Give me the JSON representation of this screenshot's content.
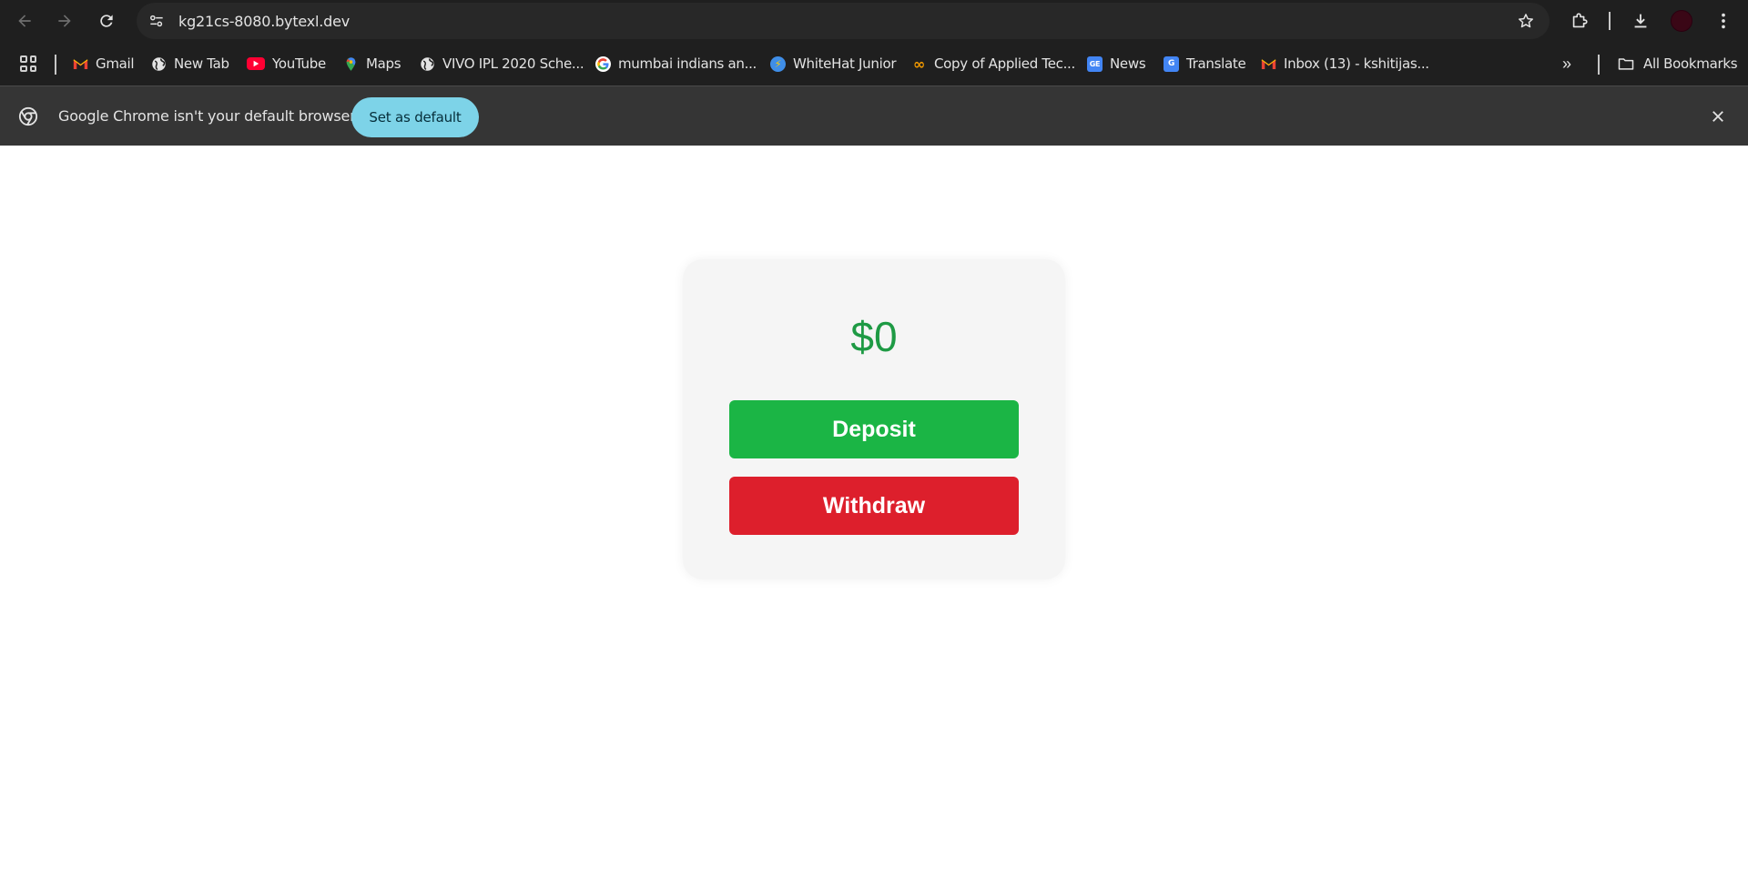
{
  "browser": {
    "url": "kg21cs-8080.bytexl.dev",
    "icons": {
      "back": "arrow-left-icon",
      "forward": "arrow-right-icon",
      "reload": "reload-icon",
      "site_settings": "tune-icon",
      "bookmark_star": "star-icon",
      "extensions": "puzzle-icon",
      "downloads": "download-icon",
      "menu": "kebab-menu-icon"
    }
  },
  "bookmarks": {
    "items": [
      {
        "label": "Gmail",
        "icon": "gmail-icon"
      },
      {
        "label": "New Tab",
        "icon": "globe-icon"
      },
      {
        "label": "YouTube",
        "icon": "youtube-icon"
      },
      {
        "label": "Maps",
        "icon": "maps-pin-icon"
      },
      {
        "label": "VIVO IPL 2020 Sche...",
        "icon": "globe-icon"
      },
      {
        "label": "mumbai indians an...",
        "icon": "google-icon"
      },
      {
        "label": "WhiteHat Junior",
        "icon": "whitehat-icon"
      },
      {
        "label": "Copy of Applied Tec...",
        "icon": "infinity-icon"
      },
      {
        "label": "News",
        "icon": "google-news-icon"
      },
      {
        "label": "Translate",
        "icon": "google-translate-icon"
      },
      {
        "label": "Inbox (13) - kshitijas...",
        "icon": "gmail-icon"
      }
    ],
    "overflow": "»",
    "all_bookmarks": "All Bookmarks"
  },
  "infobar": {
    "message": "Google Chrome isn't your default browser",
    "button": "Set as default"
  },
  "page": {
    "balance": "$0",
    "deposit_label": "Deposit",
    "withdraw_label": "Withdraw",
    "colors": {
      "balance": "#1e9a44",
      "deposit": "#1bb545",
      "withdraw": "#dd1f2c"
    }
  }
}
